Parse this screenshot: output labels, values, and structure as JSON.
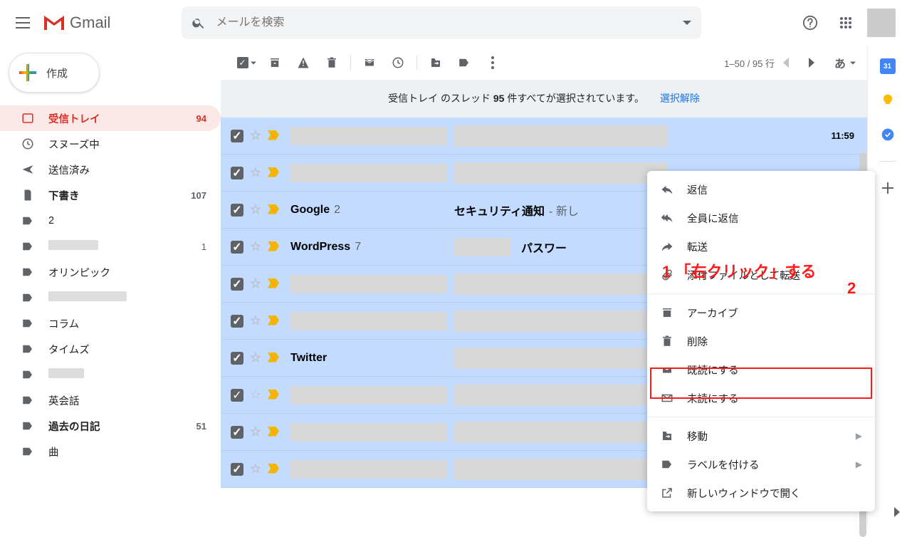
{
  "header": {
    "app_name": "Gmail",
    "search_placeholder": "メールを検索"
  },
  "compose_label": "作成",
  "sidebar": {
    "items": [
      {
        "label": "受信トレイ",
        "badge": "94",
        "active": true
      },
      {
        "label": "スヌーズ中",
        "badge": ""
      },
      {
        "label": "送信済み",
        "badge": ""
      },
      {
        "label": "下書き",
        "badge": "107",
        "bold": true
      },
      {
        "label": "2",
        "badge": ""
      },
      {
        "label": "",
        "badge": "1",
        "placeholder_width": 70
      },
      {
        "label": "オリンピック",
        "badge": ""
      },
      {
        "label": "",
        "badge": "",
        "placeholder_width": 110
      },
      {
        "label": "コラム",
        "badge": ""
      },
      {
        "label": "タイムズ",
        "badge": ""
      },
      {
        "label": "",
        "badge": "",
        "placeholder_width": 50
      },
      {
        "label": "英会話",
        "badge": ""
      },
      {
        "label": "過去の日記",
        "badge": "51",
        "bold": true
      },
      {
        "label": "曲",
        "badge": ""
      }
    ]
  },
  "toolbar": {
    "range": "1–50 / 95 行",
    "input_lang": "あ"
  },
  "banner": {
    "prefix": "受信トレイ のスレッド ",
    "count": "95",
    "suffix": " 件すべてが選択されています。",
    "link": "選択解除"
  },
  "rows": [
    {
      "sender": "",
      "sender_ph": true,
      "count": "",
      "subject": "",
      "subj_ph": true,
      "subj_pre_ph": false,
      "time": "11:59",
      "unread": true
    },
    {
      "sender": "",
      "sender_ph": true,
      "count": "",
      "subject": "",
      "subj_ph": true,
      "subj_pre_ph": false,
      "time": "",
      "unread": true
    },
    {
      "sender": "Google",
      "sender_ph": false,
      "count": "2",
      "subject": "セキュリティ通知",
      "suffix": " - 新し",
      "subj_ph": false,
      "subj_pre_ph": false,
      "time": "",
      "unread": true
    },
    {
      "sender": "WordPress",
      "sender_ph": false,
      "count": "7",
      "subject": "パスワー",
      "subj_ph": false,
      "subj_pre_ph": true,
      "time": "",
      "unread": true
    },
    {
      "sender": "",
      "sender_ph": true,
      "count": "",
      "subject": "",
      "subj_ph": true,
      "subj_pre_ph": false,
      "time": "",
      "unread": true
    },
    {
      "sender": "",
      "sender_ph": true,
      "count": "",
      "subject": "",
      "subj_ph": true,
      "subj_pre_ph": false,
      "time": "",
      "unread": true
    },
    {
      "sender": "Twitter",
      "sender_ph": false,
      "count": "",
      "subject": "",
      "subj_ph": true,
      "subj_pre_ph": false,
      "time": "",
      "unread": true
    },
    {
      "sender": "",
      "sender_ph": true,
      "count": "",
      "subject": "",
      "subj_ph": true,
      "subj_pre_ph": false,
      "time": "",
      "unread": false
    },
    {
      "sender": "",
      "sender_ph": true,
      "count": "",
      "subject": "",
      "subj_ph": true,
      "subj_pre_ph": false,
      "time": "",
      "unread": true
    },
    {
      "sender": "",
      "sender_ph": true,
      "count": "",
      "subject": "",
      "subj_ph": true,
      "subj_pre_ph": false,
      "time": "",
      "unread": true
    }
  ],
  "context_menu": {
    "items": [
      {
        "label": "返信",
        "icon": "reply"
      },
      {
        "label": "全員に返信",
        "icon": "reply-all"
      },
      {
        "label": "転送",
        "icon": "forward"
      },
      {
        "label": "添付ファイルとして転送",
        "icon": "attachment"
      }
    ],
    "items2": [
      {
        "label": "アーカイブ",
        "icon": "archive"
      },
      {
        "label": "削除",
        "icon": "trash"
      },
      {
        "label": "既読にする",
        "icon": "mark-read"
      },
      {
        "label": "未読にする",
        "icon": "mark-unread"
      }
    ],
    "items3": [
      {
        "label": "移動",
        "icon": "move",
        "submenu": true
      },
      {
        "label": "ラベルを付ける",
        "icon": "label",
        "submenu": true
      },
      {
        "label": "新しいウィンドウで開く",
        "icon": "open-new"
      }
    ]
  },
  "annotations": {
    "a1": "1 「右クリック」する",
    "a2": "2"
  }
}
